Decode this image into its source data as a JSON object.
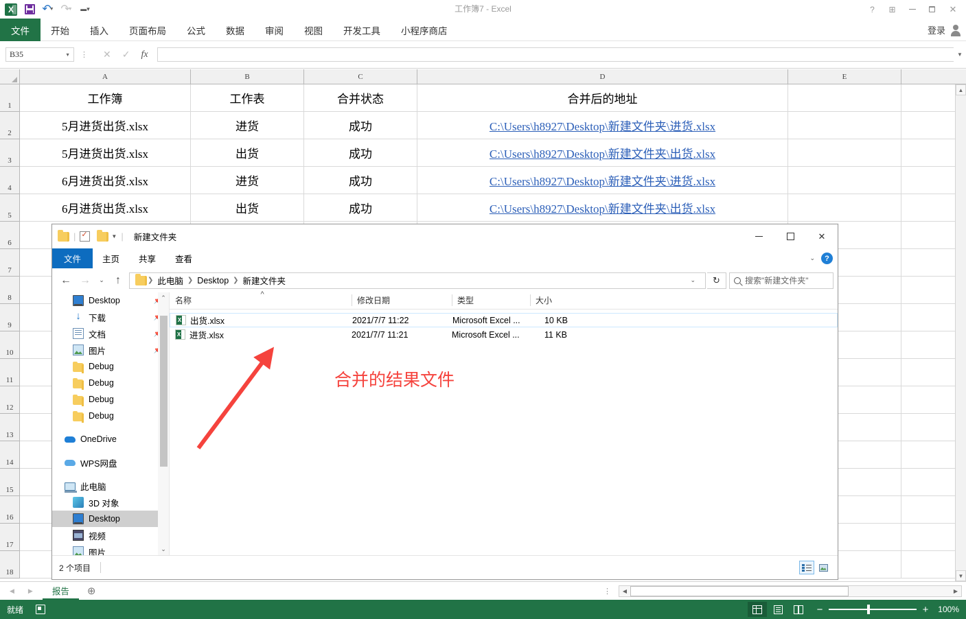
{
  "excel": {
    "title": "工作簿7 - Excel",
    "quick_access": [
      "excel-logo",
      "save-icon",
      "undo-icon",
      "redo-icon",
      "customize-qat-icon"
    ],
    "window_buttons": [
      "?",
      "ribbon-display-options",
      "minimize",
      "restore",
      "close"
    ],
    "ribbon_tabs": [
      "文件",
      "开始",
      "插入",
      "页面布局",
      "公式",
      "数据",
      "审阅",
      "视图",
      "开发工具",
      "小程序商店"
    ],
    "signin_label": "登录",
    "name_box": "B35",
    "formula_bar_value": "",
    "columns": [
      "A",
      "B",
      "C",
      "D",
      "E"
    ],
    "rows": [
      "1",
      "2",
      "3",
      "4",
      "5",
      "6",
      "7",
      "8",
      "9",
      "10",
      "11",
      "12",
      "13",
      "14",
      "15",
      "16",
      "17",
      "18"
    ],
    "sheet_data": {
      "headers": [
        "工作簿",
        "工作表",
        "合并状态",
        "合并后的地址"
      ],
      "rows": [
        {
          "a": "5月进货出货.xlsx",
          "b": "进货",
          "c": "成功",
          "d": "C:\\Users\\h8927\\Desktop\\新建文件夹\\进货.xlsx"
        },
        {
          "a": "5月进货出货.xlsx",
          "b": "出货",
          "c": "成功",
          "d": "C:\\Users\\h8927\\Desktop\\新建文件夹\\出货.xlsx"
        },
        {
          "a": "6月进货出货.xlsx",
          "b": "进货",
          "c": "成功",
          "d": "C:\\Users\\h8927\\Desktop\\新建文件夹\\进货.xlsx"
        },
        {
          "a": "6月进货出货.xlsx",
          "b": "出货",
          "c": "成功",
          "d": "C:\\Users\\h8927\\Desktop\\新建文件夹\\出货.xlsx"
        }
      ]
    },
    "sheet_tab": "报告",
    "add_sheet_label": "+",
    "status": "就绪",
    "zoom": "100%",
    "accent_color": "#217346",
    "link_color": "#2c5fb8"
  },
  "explorer": {
    "title": "新建文件夹",
    "ribbon_tabs": [
      "文件",
      "主页",
      "共享",
      "查看"
    ],
    "breadcrumb": [
      "此电脑",
      "Desktop",
      "新建文件夹"
    ],
    "search_placeholder": "搜索\"新建文件夹\"",
    "sidebar": [
      {
        "label": "Desktop",
        "icon": "desktop-icon",
        "pinned": true,
        "level": 1
      },
      {
        "label": "下载",
        "icon": "download-icon",
        "pinned": true,
        "level": 1
      },
      {
        "label": "文档",
        "icon": "document-icon",
        "pinned": true,
        "level": 1
      },
      {
        "label": "图片",
        "icon": "pictures-icon",
        "pinned": true,
        "level": 1
      },
      {
        "label": "Debug",
        "icon": "folder-icon",
        "pinned": false,
        "level": 1
      },
      {
        "label": "Debug",
        "icon": "folder-icon",
        "pinned": false,
        "level": 1
      },
      {
        "label": "Debug",
        "icon": "folder-icon",
        "pinned": false,
        "level": 1
      },
      {
        "label": "Debug",
        "icon": "folder-icon",
        "pinned": false,
        "level": 1
      },
      {
        "label": "OneDrive",
        "icon": "onedrive-icon",
        "pinned": false,
        "level": 0
      },
      {
        "label": "WPS网盘",
        "icon": "wps-cloud-icon",
        "pinned": false,
        "level": 0
      },
      {
        "label": "此电脑",
        "icon": "this-pc-icon",
        "pinned": false,
        "level": 0
      },
      {
        "label": "3D 对象",
        "icon": "3d-objects-icon",
        "pinned": false,
        "level": 1
      },
      {
        "label": "Desktop",
        "icon": "desktop-icon",
        "pinned": false,
        "level": 1,
        "selected": true
      },
      {
        "label": "视频",
        "icon": "videos-icon",
        "pinned": false,
        "level": 1
      },
      {
        "label": "图片",
        "icon": "pictures-icon",
        "pinned": false,
        "level": 1
      }
    ],
    "list_headers": [
      "名称",
      "修改日期",
      "类型",
      "大小"
    ],
    "files": [
      {
        "name": "出货.xlsx",
        "date": "2021/7/7 11:22",
        "type": "Microsoft Excel ...",
        "size": "10 KB",
        "icon": "excel-file-icon",
        "selected": true
      },
      {
        "name": "进货.xlsx",
        "date": "2021/7/7 11:21",
        "type": "Microsoft Excel ...",
        "size": "11 KB",
        "icon": "excel-file-icon",
        "selected": false
      }
    ],
    "status": "2 个项目",
    "window_buttons": [
      "minimize",
      "maximize",
      "close"
    ],
    "annotation": {
      "text": "合并的结果文件",
      "color": "#f5433d"
    }
  }
}
